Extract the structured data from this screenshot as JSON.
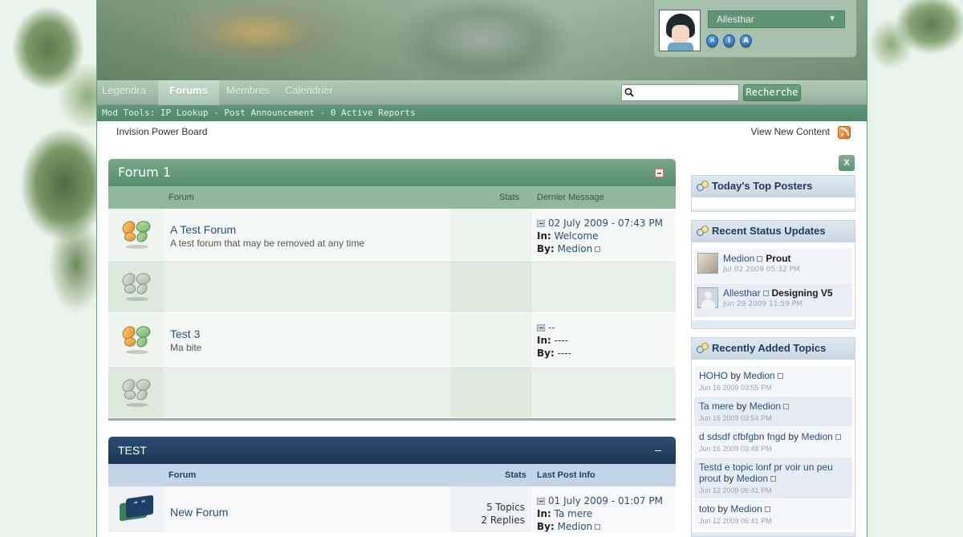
{
  "header": {
    "username": "Allesthar",
    "user_icons": [
      "✕",
      "i",
      "A"
    ]
  },
  "nav": {
    "tabs": [
      {
        "label": "Legendra"
      },
      {
        "label": "Forums"
      },
      {
        "label": "Membres"
      },
      {
        "label": "Calendrier"
      }
    ],
    "search_value": "",
    "search_button": "Recherche"
  },
  "modbar": {
    "prefix": "Mod Tools:",
    "items": [
      "IP Lookup",
      "Post Announcement",
      "0 Active Reports"
    ],
    "separator": " - "
  },
  "breadcrumb": "Invision Power Board",
  "view_new_content": "View New Content",
  "categories": [
    {
      "title": "Forum 1",
      "columns": {
        "forum": "Forum",
        "stats": "Stats",
        "last": "Dernier Message"
      },
      "rows": [
        {
          "name": "A Test Forum",
          "desc": "A test forum that may be removed at any time",
          "stats": "",
          "last_date": "02 July 2009 - 07:43 PM",
          "in_label": "In:",
          "in": "Welcome",
          "by_label": "By:",
          "by": "Medion"
        },
        {
          "name": "",
          "desc": "",
          "stats": "",
          "last_date": "",
          "in": "",
          "by": ""
        },
        {
          "name": "Test 3",
          "desc": "Ma bite",
          "stats": "",
          "last_date": "--",
          "in_label": "In:",
          "in": "----",
          "by_label": "By:",
          "by": "----"
        },
        {
          "name": "",
          "desc": "",
          "stats": "",
          "last_date": "",
          "in": "",
          "by": ""
        }
      ]
    },
    {
      "title": "TEST",
      "columns": {
        "forum": "Forum",
        "stats": "Stats",
        "last": "Last Post Info"
      },
      "rows": [
        {
          "name": "New Forum",
          "desc": "",
          "topics": "5 Topics",
          "replies": "2 Replies",
          "last_date": "01 July 2009 - 01:07 PM",
          "in_label": "In:",
          "in": "Ta mere",
          "by_label": "By:",
          "by": "Medion"
        }
      ]
    }
  ],
  "sidebar": {
    "close_label": "X",
    "top_posters": {
      "title": "Today's Top Posters"
    },
    "status_updates": {
      "title": "Recent Status Updates",
      "items": [
        {
          "name": "Medion",
          "text": "Prout",
          "date": "Jul 02 2009 05:32 PM"
        },
        {
          "name": "Allesthar",
          "text": "Designing V5",
          "date": "Jun 29 2009 11:59 PM"
        }
      ]
    },
    "recent_topics": {
      "title": "Recently Added Topics",
      "by_word": "by",
      "items": [
        {
          "title": "HOHO",
          "author": "Medion",
          "date": "Jun 16 2009 03:55 PM"
        },
        {
          "title": "Ta mere",
          "author": "Medion",
          "date": "Jun 16 2009 03:54 PM"
        },
        {
          "title": "d sdsdf cfbfgbn fngd",
          "author": "Medion",
          "date": "Jun 16 2009 03:48 PM"
        },
        {
          "title": "Testd e topic lonf pr voir un peu prout",
          "author": "Medion",
          "date": "Jun 12 2009 06:41 PM"
        },
        {
          "title": "toto",
          "author": "Medion",
          "date": "Jun 12 2009 06:41 PM"
        }
      ]
    }
  },
  "colors": {
    "accent_green": "#578e6c",
    "accent_blue": "#1a3656",
    "link": "#2b4f7a"
  }
}
